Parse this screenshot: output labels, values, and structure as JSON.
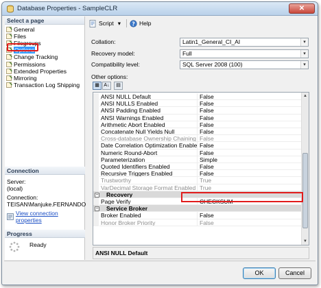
{
  "window": {
    "title": "Database Properties - SampleCLR",
    "close_glyph": "✕"
  },
  "left": {
    "select_page_header": "Select a page",
    "pages": [
      {
        "label": "General",
        "icon": "page-icon"
      },
      {
        "label": "Files",
        "icon": "page-icon"
      },
      {
        "label": "Filegroups",
        "icon": "page-icon"
      },
      {
        "label": "Options",
        "icon": "page-icon",
        "selected": true
      },
      {
        "label": "Change Tracking",
        "icon": "page-icon"
      },
      {
        "label": "Permissions",
        "icon": "page-icon"
      },
      {
        "label": "Extended Properties",
        "icon": "page-icon"
      },
      {
        "label": "Mirroring",
        "icon": "page-icon"
      },
      {
        "label": "Transaction Log Shipping",
        "icon": "page-icon"
      }
    ],
    "connection": {
      "header": "Connection",
      "server_label": "Server:",
      "server_value": "(local)",
      "connection_label": "Connection:",
      "connection_value": "TEISAN\\Manjuke.FERNANDO",
      "link_text": "View connection properties"
    },
    "progress": {
      "header": "Progress",
      "status": "Ready"
    }
  },
  "toolbar": {
    "script_label": "Script",
    "help_label": "Help",
    "dropdown_glyph": "▾"
  },
  "fields": {
    "collation_label": "Collation:",
    "collation_value": "Latin1_General_CI_AI",
    "recovery_label": "Recovery model:",
    "recovery_value": "Full",
    "compat_label": "Compatibility level:",
    "compat_value": "SQL Server 2008 (100)",
    "combo_arrow": "▾"
  },
  "other_options_label": "Other options:",
  "grid_buttons": {
    "categorized": "▦",
    "alphabetical": "A↓",
    "pages": "▤"
  },
  "grid": {
    "rows": [
      {
        "name": "ANSI NULL Default",
        "value": "False"
      },
      {
        "name": "ANSI NULLS Enabled",
        "value": "False"
      },
      {
        "name": "ANSI Padding Enabled",
        "value": "False"
      },
      {
        "name": "ANSI Warnings Enabled",
        "value": "False"
      },
      {
        "name": "Arithmetic Abort Enabled",
        "value": "False"
      },
      {
        "name": "Concatenate Null Yields Null",
        "value": "False"
      },
      {
        "name": "Cross-database Ownership Chaining Enabled",
        "value": "False",
        "disabled": true
      },
      {
        "name": "Date Correlation Optimization Enabled",
        "value": "False"
      },
      {
        "name": "Numeric Round-Abort",
        "value": "False"
      },
      {
        "name": "Parameterization",
        "value": "Simple"
      },
      {
        "name": "Quoted Identifiers Enabled",
        "value": "False"
      },
      {
        "name": "Recursive Triggers Enabled",
        "value": "False"
      },
      {
        "name": "Trustworthy",
        "value": "True",
        "disabled": true
      },
      {
        "name": "VarDecimal Storage Format Enabled",
        "value": "True",
        "disabled": true
      },
      {
        "category": true,
        "name": "Recovery"
      },
      {
        "name": "Page Verify",
        "value": "CHECKSUM"
      },
      {
        "category": true,
        "name": "Service Broker"
      },
      {
        "name": "Broker Enabled",
        "value": "False"
      },
      {
        "name": "Honor Broker Priority",
        "value": "False",
        "disabled": true
      }
    ],
    "expander_glyph": "−",
    "scroll_up": "▲",
    "scroll_down": "▼"
  },
  "description": "ANSI NULL Default",
  "buttons": {
    "ok": "OK",
    "cancel": "Cancel"
  }
}
